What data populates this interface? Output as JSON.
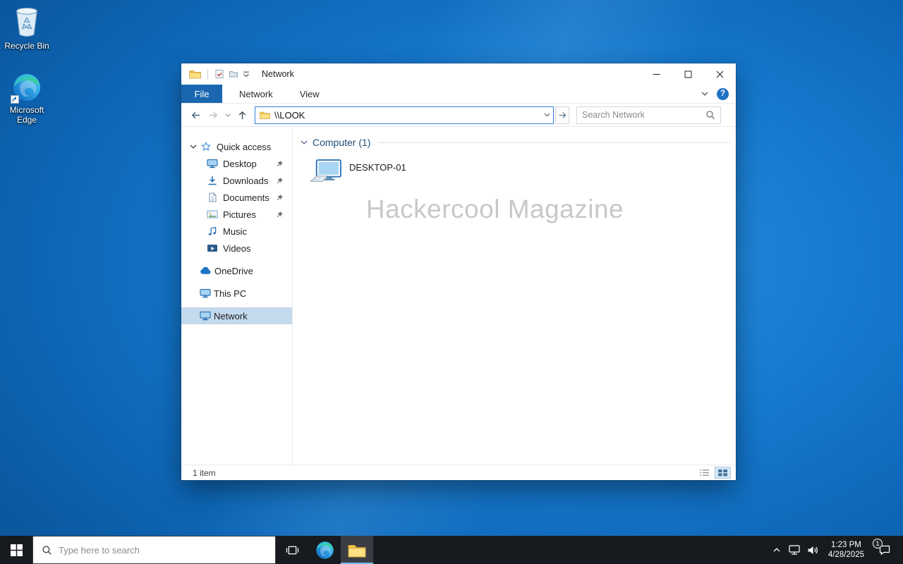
{
  "desktop": {
    "icons": [
      {
        "label": "Recycle Bin"
      },
      {
        "label": "Microsoft Edge"
      }
    ]
  },
  "window": {
    "title": "Network",
    "menu": {
      "file_tab": "File",
      "tabs": [
        {
          "label": "Network"
        },
        {
          "label": "View"
        }
      ]
    },
    "navigation": {
      "address": "\\\\LOOK",
      "search_placeholder": "Search Network"
    },
    "sidebar": {
      "items": [
        {
          "label": "Quick access"
        },
        {
          "label": "Desktop"
        },
        {
          "label": "Downloads"
        },
        {
          "label": "Documents"
        },
        {
          "label": "Pictures"
        },
        {
          "label": "Music"
        },
        {
          "label": "Videos"
        },
        {
          "label": "OneDrive"
        },
        {
          "label": "This PC"
        },
        {
          "label": "Network"
        }
      ]
    },
    "content": {
      "group_header": "Computer (1)",
      "items": [
        {
          "label": "DESKTOP-01"
        }
      ],
      "watermark": "Hackercool Magazine"
    },
    "statusbar": {
      "item_count": "1 item"
    }
  },
  "taskbar": {
    "search_placeholder": "Type here to search",
    "clock": {
      "time": "1:23 PM",
      "date": "4/28/2025"
    },
    "notifications": {
      "badge": "1"
    }
  }
}
